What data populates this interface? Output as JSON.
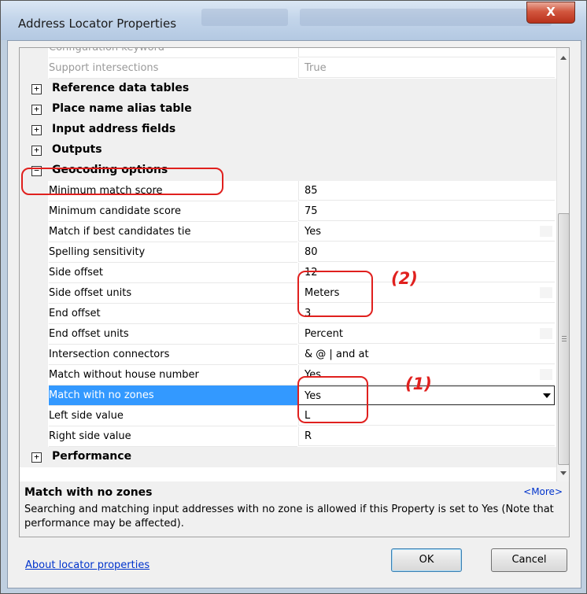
{
  "window": {
    "title": "Address Locator Properties",
    "close_label": "X"
  },
  "grid": {
    "rows": [
      {
        "kind": "prop",
        "label": "Configuration keyword",
        "value": "",
        "dim": true
      },
      {
        "kind": "prop",
        "label": "Support intersections",
        "value": "True",
        "dim": true
      },
      {
        "kind": "category",
        "label": "Reference data tables",
        "expander": "+"
      },
      {
        "kind": "category",
        "label": "Place name alias table",
        "expander": "+"
      },
      {
        "kind": "category",
        "label": "Input address fields",
        "expander": "+"
      },
      {
        "kind": "category",
        "label": "Outputs",
        "expander": "+"
      },
      {
        "kind": "category",
        "label": "Geocoding options",
        "expander": "−"
      },
      {
        "kind": "prop",
        "label": "Minimum match score",
        "value": "85"
      },
      {
        "kind": "prop",
        "label": "Minimum candidate score",
        "value": "75"
      },
      {
        "kind": "prop",
        "label": "Match if best candidates tie",
        "value": "Yes",
        "ghost": true
      },
      {
        "kind": "prop",
        "label": "Spelling sensitivity",
        "value": "80"
      },
      {
        "kind": "prop",
        "label": "Side offset",
        "value": "12"
      },
      {
        "kind": "prop",
        "label": "Side offset units",
        "value": "Meters",
        "ghost": true
      },
      {
        "kind": "prop",
        "label": "End offset",
        "value": "3"
      },
      {
        "kind": "prop",
        "label": "End offset units",
        "value": "Percent",
        "ghost": true
      },
      {
        "kind": "prop",
        "label": "Intersection connectors",
        "value": "& @ | and at"
      },
      {
        "kind": "prop",
        "label": "Match without house number",
        "value": "Yes",
        "ghost": true
      },
      {
        "kind": "prop",
        "label": "Match with no zones",
        "value": "Yes",
        "selected": true
      },
      {
        "kind": "prop",
        "label": "Left side value",
        "value": "L"
      },
      {
        "kind": "prop",
        "label": "Right side value",
        "value": "R"
      },
      {
        "kind": "category",
        "label": "Performance",
        "expander": "+"
      }
    ]
  },
  "description": {
    "title": "Match with no zones",
    "more": "<More>",
    "text": "Searching and matching input addresses with no zone is allowed if this Property is set to Yes (Note that performance may be affected)."
  },
  "footer": {
    "link": "About locator properties",
    "ok": "OK",
    "cancel": "Cancel"
  },
  "annotations": {
    "label_1": "(1)",
    "label_2": "(2)",
    "color": "#e0201e"
  }
}
